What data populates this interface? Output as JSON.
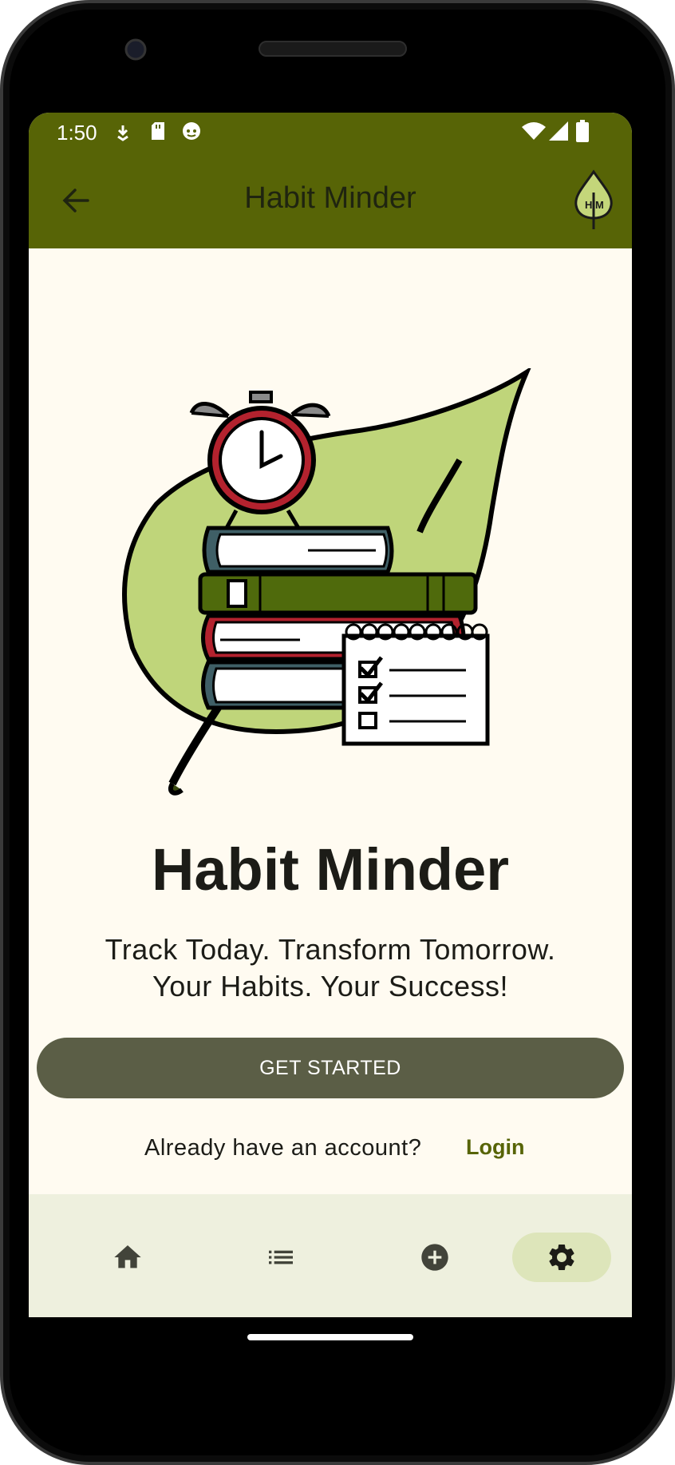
{
  "status_bar": {
    "time": "1:50",
    "icons": [
      "download-icon",
      "sd-card-icon",
      "face-icon",
      "wifi-icon",
      "signal-icon",
      "battery-icon"
    ]
  },
  "app_bar": {
    "title": "Habit Minder",
    "back_icon": "arrow-left-icon",
    "logo": "leaf-logo-icon"
  },
  "hero": {
    "illustration": "leaf-books-clock-checklist-illustration"
  },
  "content": {
    "headline": "Habit Minder",
    "tagline_line1": "Track Today. Transform Tomorrow.",
    "tagline_line2": "Your Habits. Your Success!",
    "cta_label": "GET STARTED",
    "account_prompt": "Already have an account?",
    "login_label": "Login"
  },
  "bottom_nav": {
    "items": [
      {
        "icon": "home-icon",
        "active": false
      },
      {
        "icon": "list-icon",
        "active": false
      },
      {
        "icon": "add-circle-icon",
        "active": false
      },
      {
        "icon": "gear-icon",
        "active": true
      }
    ]
  },
  "colors": {
    "app_bar": "#576406",
    "background": "#fffbf1",
    "button": "#5b5e46",
    "accent": "#576406",
    "nav_bar": "#eef0de",
    "nav_active": "#dde5ba"
  }
}
